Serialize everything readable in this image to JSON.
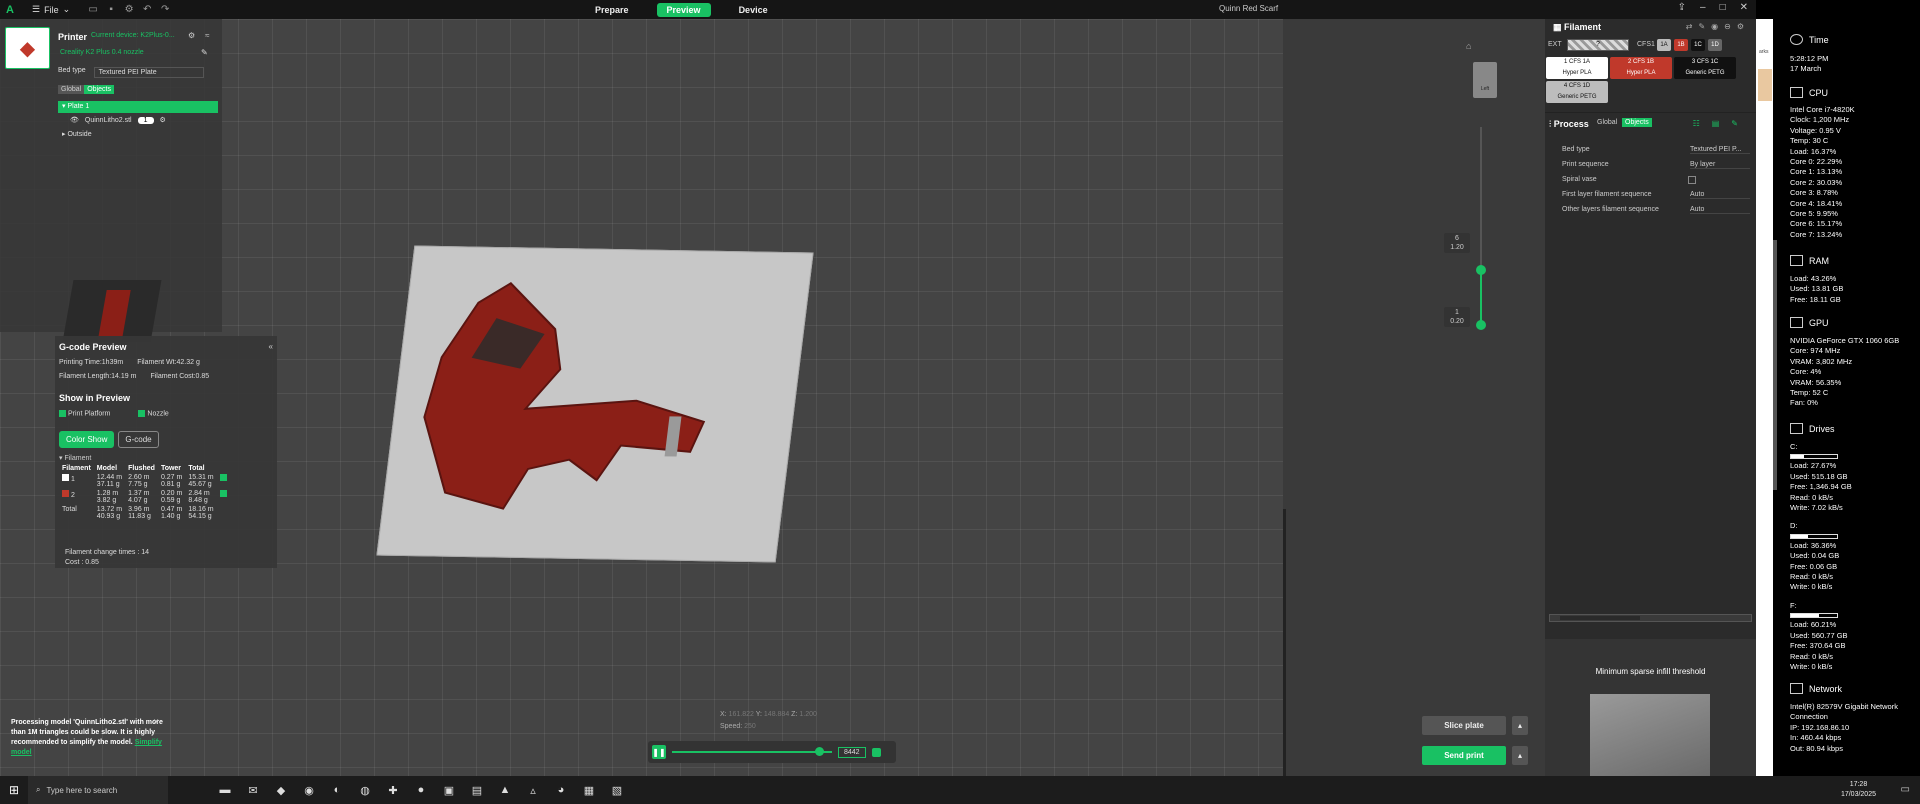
{
  "app": {
    "logo": "A",
    "menu_file": "File",
    "window_title": "Quinn Red Scarf",
    "accent": "#19c163"
  },
  "tabs": [
    {
      "label": "Prepare"
    },
    {
      "label": "Preview"
    },
    {
      "label": "Device"
    }
  ],
  "printer": {
    "title": "Printer",
    "sub1": "Current device: K2Plus-0...",
    "sub2": "Creality K2 Plus 0.4 nozzle",
    "bed_type_label": "Bed type",
    "bed_type_value": "Textured PEI Plate",
    "global": "Global",
    "objects": "Objects",
    "plate": "Plate 1",
    "object_name": "QuinnLitho2.stl",
    "object_count": "1",
    "outside": "Outside"
  },
  "gcode": {
    "title": "G-code Preview",
    "printing_time": "Printing Time:1h39m",
    "filament_wt": "Filament Wt:42.32 g",
    "filament_length": "Filament Length:14.19 m",
    "filament_cost": "Filament Cost:0.85",
    "show_title": "Show in Preview",
    "print_platform": "Print Platform",
    "nozzle": "Nozzle",
    "color_show": "Color Show",
    "gcode_btn": "G-code",
    "filament_header": "Filament",
    "table_headers": [
      "Filament",
      "Model",
      "Flushed",
      "Tower",
      "Total"
    ],
    "rows": [
      {
        "color": "#ffffff",
        "id": "1",
        "model": "12.44 m\n37.11 g",
        "flushed": "2.60 m\n7.75 g",
        "tower": "0.27 m\n0.81 g",
        "total": "15.31 m\n45.67 g"
      },
      {
        "color": "#c0392b",
        "id": "2",
        "model": "1.28 m\n3.82 g",
        "flushed": "1.37 m\n4.07 g",
        "tower": "0.20 m\n0.59 g",
        "total": "2.84 m\n8.48 g"
      }
    ],
    "total_row": {
      "label": "Total",
      "model": "13.72 m\n40.93 g",
      "flushed": "3.96 m\n11.83 g",
      "tower": "0.47 m\n1.40 g",
      "total": "18.16 m\n54.15 g"
    },
    "change_times": "Filament change times : 14",
    "cost": "Cost : 0.85"
  },
  "notice": {
    "text": "Processing model 'QuinnLitho2.stl' with more than 1M triangles could be slow. It is highly recommended to simplify the model.",
    "link": "Simplify model"
  },
  "coords": {
    "x_label": "X:",
    "x": "161.822",
    "y_label": "Y:",
    "y": "148.884",
    "z_label": "Z:",
    "z": "1.200",
    "speed_label": "Speed:",
    "speed": "250"
  },
  "player": {
    "value": "8442"
  },
  "layers": {
    "top_num": "6",
    "top_h": "1.20",
    "bottom_num": "1",
    "bottom_h": "0.20",
    "view_label": "Left"
  },
  "buttons": {
    "slice": "Slice plate",
    "send": "Send print"
  },
  "filament_panel": {
    "title": "Filament",
    "ext_label": "EXT",
    "ext_value": "?",
    "cfs_label": "CFS1",
    "slots": [
      "1A",
      "1B",
      "1C",
      "1D"
    ],
    "spools": [
      {
        "num": "1",
        "tag": "CFS 1A",
        "type": "Hyper PLA",
        "color": "#ffffff"
      },
      {
        "num": "2",
        "tag": "CFS 1B",
        "type": "Hyper PLA",
        "color": "#c0392b"
      },
      {
        "num": "3",
        "tag": "CFS 1C",
        "type": "Generic PETG",
        "color": "#111111"
      },
      {
        "num": "4",
        "tag": "CFS 1D",
        "type": "Generic PETG",
        "color": "#bdbdbd"
      }
    ]
  },
  "process": {
    "title": "Process",
    "global": "Global",
    "objects": "Objects",
    "settings": [
      {
        "label": "Bed type",
        "value": "Textured PEI P..."
      },
      {
        "label": "Print sequence",
        "value": "By layer"
      },
      {
        "label": "Spiral vase",
        "value": ""
      },
      {
        "label": "First layer filament sequence",
        "value": "Auto"
      },
      {
        "label": "Other layers filament sequence",
        "value": "Auto"
      }
    ],
    "tip_title": "Minimum sparse infill threshold"
  },
  "monitor": {
    "time_title": "Time",
    "time": "5:28:12 PM",
    "date": "17 March",
    "cpu_title": "CPU",
    "cpu_lines": [
      "Intel Core i7-4820K",
      "Clock: 1,200 MHz",
      "Voltage: 0.95 V",
      "Temp: 30 C",
      "Load: 16.37%",
      "Core 0: 22.29%",
      "Core 1: 13.13%",
      "Core 2: 30.03%",
      "Core 3: 8.78%",
      "Core 4: 18.41%",
      "Core 5: 9.95%",
      "Core 6: 15.17%",
      "Core 7: 13.24%"
    ],
    "ram_title": "RAM",
    "ram_lines": [
      "Load: 43.26%",
      "Used: 13.81 GB",
      "Free: 18.11 GB"
    ],
    "gpu_title": "GPU",
    "gpu_lines": [
      "NVIDIA GeForce GTX 1060 6GB",
      "Core: 974 MHz",
      "VRAM: 3,802 MHz",
      "Core: 4%",
      "VRAM: 56.35%",
      "Temp: 52 C",
      "Fan: 0%"
    ],
    "drives_title": "Drives",
    "drives": [
      {
        "name": "C:",
        "load_pct": 0.2767,
        "lines": [
          "Load: 27.67%",
          "Used: 515.18 GB",
          "Free: 1,346.94 GB",
          "Read: 0 kB/s",
          "Write: 7.02 kB/s"
        ]
      },
      {
        "name": "D:",
        "load_pct": 0.3636,
        "lines": [
          "Load: 36.36%",
          "Used: 0.04 GB",
          "Free: 0.06 GB",
          "Read: 0 kB/s",
          "Write: 0 kB/s"
        ]
      },
      {
        "name": "F:",
        "load_pct": 0.6021,
        "lines": [
          "Load: 60.21%",
          "Used: 560.77 GB",
          "Free: 370.64 GB",
          "Read: 0 kB/s",
          "Write: 0 kB/s"
        ]
      }
    ],
    "net_title": "Network",
    "net_lines": [
      "Intel(R) 82579V Gigabit Network",
      "Connection",
      "IP: 192.168.86.10",
      "In: 460.44 kbps",
      "Out: 80.94 kbps"
    ]
  },
  "taskbar": {
    "search": "Type here to search",
    "time": "17:28",
    "date": "17/03/2025"
  },
  "side_strip": "arks"
}
